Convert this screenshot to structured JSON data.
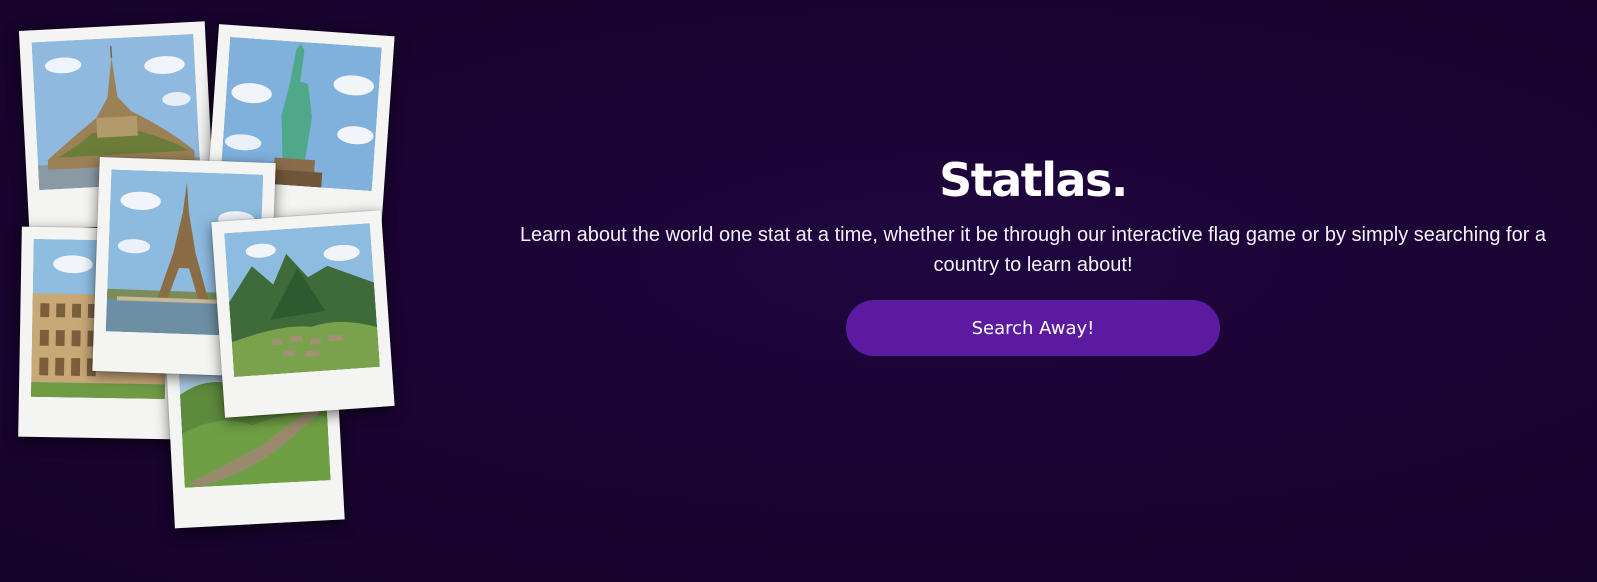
{
  "hero": {
    "brand": "Statlas.",
    "tagline": "Learn about the world one stat at a time, whether it be through our interactive flag game or by simply searching for a country to learn about!",
    "cta_label": "Search Away!"
  },
  "collage": {
    "photos": [
      {
        "subject": "Mont Saint-Michel"
      },
      {
        "subject": "Statue of Liberty"
      },
      {
        "subject": "Colosseum"
      },
      {
        "subject": "Great Wall of China"
      },
      {
        "subject": "Eiffel Tower"
      },
      {
        "subject": "Machu Picchu"
      }
    ]
  },
  "colors": {
    "background": "#1a0435",
    "accent": "#5b1aa0",
    "text": "#ffffff"
  }
}
